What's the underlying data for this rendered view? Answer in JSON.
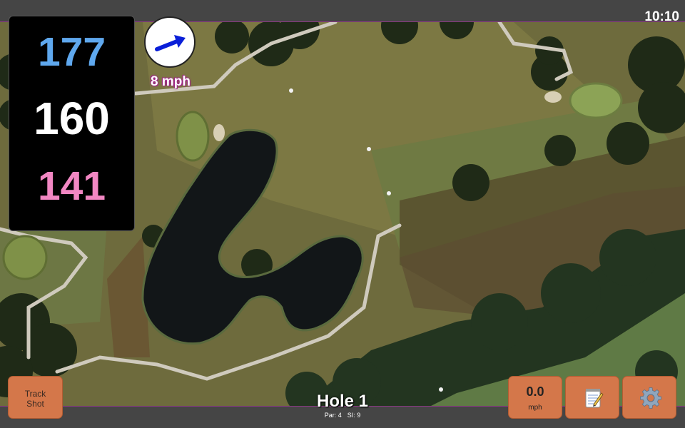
{
  "status": {
    "time": "10:10"
  },
  "distances": {
    "back": "177",
    "middle": "160",
    "front": "141"
  },
  "colors": {
    "back": "#5fa8ee",
    "middle": "#ffffff",
    "front": "#f287c3",
    "button": "#d4774a",
    "arrow": "#0a1fd8"
  },
  "wind": {
    "speed": "8 mph",
    "direction_icon": "arrow-up-right-icon"
  },
  "buttons": {
    "track_shot": "Track\nShot",
    "speed_value": "0.0",
    "speed_unit": "mph",
    "notes_icon": "notepad-icon",
    "settings_icon": "gear-icon"
  },
  "hole": {
    "title": "Hole 1",
    "par": "Par: 4",
    "si": "SI: 9"
  }
}
